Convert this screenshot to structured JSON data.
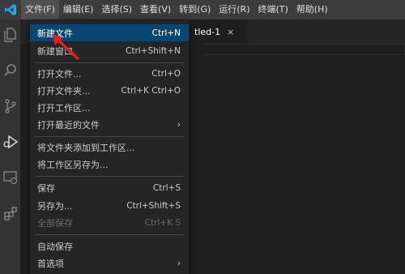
{
  "colors": {
    "accent": "#0078d4",
    "menu_highlight": "#094771",
    "annotation_arrow": "#e02020"
  },
  "menubar": {
    "logo_icon": "vscode-logo-icon",
    "items": [
      "文件(F)",
      "编辑(E)",
      "选择(S)",
      "查看(V)",
      "转到(G)",
      "运行(R)",
      "终端(T)",
      "帮助(H)"
    ]
  },
  "activitybar": {
    "icons": [
      "files-icon",
      "search-icon",
      "source-control-icon",
      "run-debug-icon",
      "remote-explorer-icon",
      "extensions-icon"
    ]
  },
  "editor": {
    "tab_title": "tled-1",
    "tab_close": "×"
  },
  "file_menu": {
    "new_file": {
      "label": "新建文件",
      "key": "Ctrl+N"
    },
    "new_window": {
      "label": "新建窗口",
      "key": "Ctrl+Shift+N"
    },
    "open_file": {
      "label": "打开文件...",
      "key": "Ctrl+O"
    },
    "open_folder": {
      "label": "打开文件夹...",
      "key": "Ctrl+K Ctrl+O"
    },
    "open_workspace": {
      "label": "打开工作区..."
    },
    "open_recent": {
      "label": "打开最近的文件"
    },
    "add_folder_to_workspace": {
      "label": "将文件夹添加到工作区..."
    },
    "save_workspace_as": {
      "label": "将工作区另存为..."
    },
    "save": {
      "label": "保存",
      "key": "Ctrl+S"
    },
    "save_as": {
      "label": "另存为...",
      "key": "Ctrl+Shift+S"
    },
    "save_all": {
      "label": "全部保存",
      "key": "Ctrl+K S"
    },
    "auto_save": {
      "label": "自动保存"
    },
    "preferences": {
      "label": "首选项"
    },
    "submenu_arrow": "›"
  }
}
